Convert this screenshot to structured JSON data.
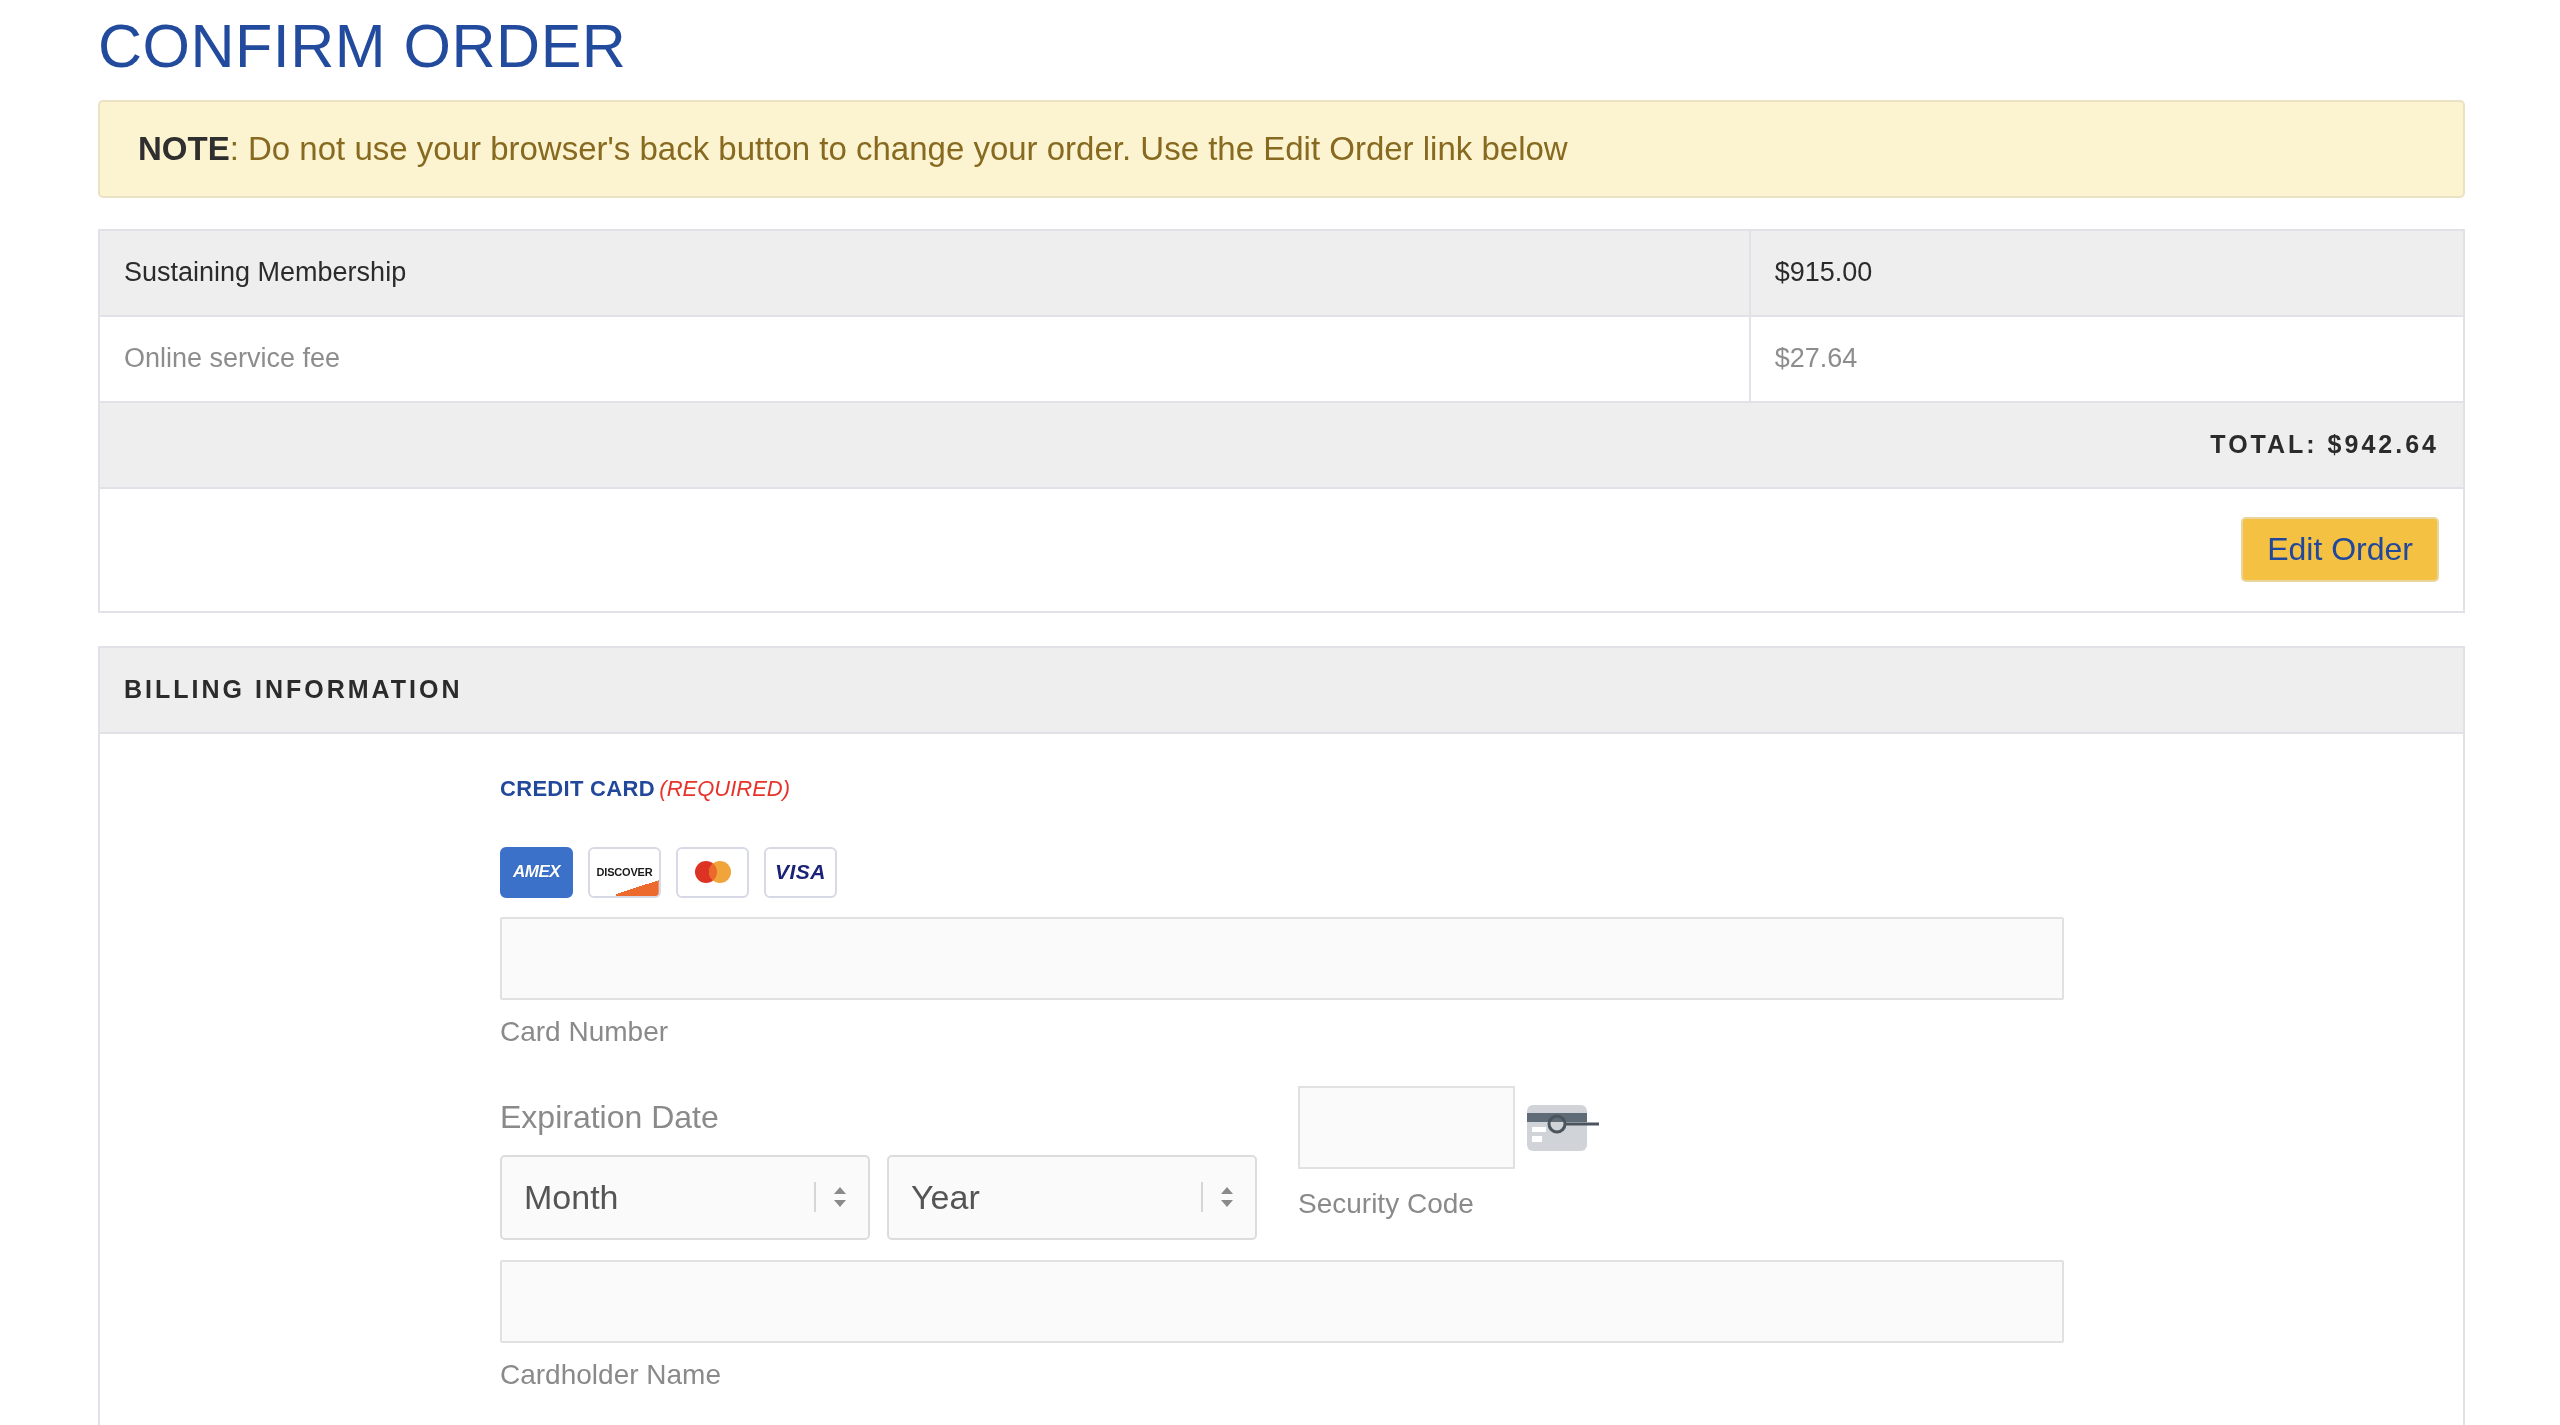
{
  "page_title": "CONFIRM ORDER",
  "notice": {
    "text": "**NOTE**: Do not use your browser's back button to change your order. Use the Edit Order link below"
  },
  "order": {
    "items": [
      {
        "kind": "item",
        "name": "Sustaining Membership",
        "price": "$915.00"
      },
      {
        "kind": "fee",
        "name": "Online service fee",
        "price": "$27.64"
      }
    ],
    "total": "TOTAL: $942.64",
    "edit_button": "Edit Order"
  },
  "billing": {
    "title": "BILLING INFORMATION",
    "credit_card": {
      "label": "CREDIT CARD",
      "required_note": "(REQUIRED)",
      "logos": [
        {
          "kind": "amex",
          "label": "AMEX"
        },
        {
          "kind": "discover",
          "label": "DISCOVER"
        },
        {
          "kind": "mastercard"
        },
        {
          "kind": "visa",
          "label": "VISA"
        }
      ],
      "card_number": {
        "label": "Card Number"
      },
      "expiration": {
        "label": "Expiration Date",
        "month": {
          "value": "Month"
        },
        "year": {
          "value": "Year"
        }
      },
      "security_code": {
        "label": "Security Code"
      },
      "cardholder_name": {
        "label": "Cardholder Name"
      }
    }
  }
}
